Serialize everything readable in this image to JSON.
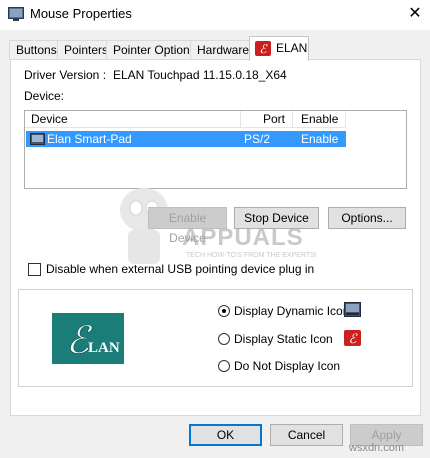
{
  "window": {
    "title": "Mouse Properties",
    "close_glyph": "✕"
  },
  "tabs": [
    {
      "label": "Buttons",
      "active": false
    },
    {
      "label": "Pointers",
      "active": false
    },
    {
      "label": "Pointer Options",
      "active": false
    },
    {
      "label": "Hardware",
      "active": false
    },
    {
      "label": "ELAN",
      "active": true
    }
  ],
  "driver": {
    "label": "Driver Version :",
    "value": "ELAN Touchpad 11.15.0.18_X64"
  },
  "device_section_label": "Device:",
  "device_table": {
    "columns": [
      "Device",
      "Port",
      "Enable"
    ],
    "rows": [
      {
        "device": "Elan Smart-Pad",
        "port": "PS/2",
        "enable": "Enable",
        "selected": true
      }
    ]
  },
  "device_buttons": {
    "enable_device": "Enable Device",
    "stop_device": "Stop Device",
    "options": "Options..."
  },
  "disable_usb_checkbox": {
    "label": "Disable when external USB pointing device plug in",
    "checked": false
  },
  "icon_display": {
    "logo_text": "LAN",
    "logo_letter": "E",
    "options": [
      {
        "label": "Display Dynamic Icon",
        "checked": true
      },
      {
        "label": "Display Static Icon",
        "checked": false
      },
      {
        "label": "Do Not Display Icon",
        "checked": false
      }
    ]
  },
  "footer_buttons": {
    "ok": "OK",
    "cancel": "Cancel",
    "apply": "Apply"
  },
  "watermark": {
    "main": "APPUALS",
    "sub": "TECH HOW-TO'S FROM THE EXPERTS!"
  },
  "site_mark": "wsxdn.com",
  "colors": {
    "selection": "#3399ff",
    "elan_red": "#cc1f1f",
    "elan_teal": "#1a7d78",
    "accent": "#0078d7"
  }
}
